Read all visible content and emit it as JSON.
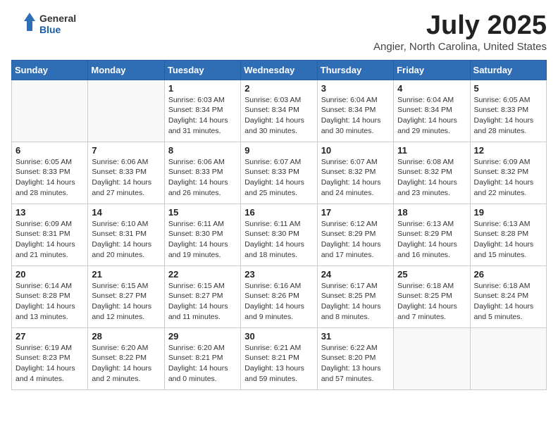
{
  "header": {
    "logo_general": "General",
    "logo_blue": "Blue",
    "month_title": "July 2025",
    "location": "Angier, North Carolina, United States"
  },
  "weekdays": [
    "Sunday",
    "Monday",
    "Tuesday",
    "Wednesday",
    "Thursday",
    "Friday",
    "Saturday"
  ],
  "weeks": [
    [
      {
        "day": "",
        "info": ""
      },
      {
        "day": "",
        "info": ""
      },
      {
        "day": "1",
        "info": "Sunrise: 6:03 AM\nSunset: 8:34 PM\nDaylight: 14 hours and 31 minutes."
      },
      {
        "day": "2",
        "info": "Sunrise: 6:03 AM\nSunset: 8:34 PM\nDaylight: 14 hours and 30 minutes."
      },
      {
        "day": "3",
        "info": "Sunrise: 6:04 AM\nSunset: 8:34 PM\nDaylight: 14 hours and 30 minutes."
      },
      {
        "day": "4",
        "info": "Sunrise: 6:04 AM\nSunset: 8:34 PM\nDaylight: 14 hours and 29 minutes."
      },
      {
        "day": "5",
        "info": "Sunrise: 6:05 AM\nSunset: 8:33 PM\nDaylight: 14 hours and 28 minutes."
      }
    ],
    [
      {
        "day": "6",
        "info": "Sunrise: 6:05 AM\nSunset: 8:33 PM\nDaylight: 14 hours and 28 minutes."
      },
      {
        "day": "7",
        "info": "Sunrise: 6:06 AM\nSunset: 8:33 PM\nDaylight: 14 hours and 27 minutes."
      },
      {
        "day": "8",
        "info": "Sunrise: 6:06 AM\nSunset: 8:33 PM\nDaylight: 14 hours and 26 minutes."
      },
      {
        "day": "9",
        "info": "Sunrise: 6:07 AM\nSunset: 8:33 PM\nDaylight: 14 hours and 25 minutes."
      },
      {
        "day": "10",
        "info": "Sunrise: 6:07 AM\nSunset: 8:32 PM\nDaylight: 14 hours and 24 minutes."
      },
      {
        "day": "11",
        "info": "Sunrise: 6:08 AM\nSunset: 8:32 PM\nDaylight: 14 hours and 23 minutes."
      },
      {
        "day": "12",
        "info": "Sunrise: 6:09 AM\nSunset: 8:32 PM\nDaylight: 14 hours and 22 minutes."
      }
    ],
    [
      {
        "day": "13",
        "info": "Sunrise: 6:09 AM\nSunset: 8:31 PM\nDaylight: 14 hours and 21 minutes."
      },
      {
        "day": "14",
        "info": "Sunrise: 6:10 AM\nSunset: 8:31 PM\nDaylight: 14 hours and 20 minutes."
      },
      {
        "day": "15",
        "info": "Sunrise: 6:11 AM\nSunset: 8:30 PM\nDaylight: 14 hours and 19 minutes."
      },
      {
        "day": "16",
        "info": "Sunrise: 6:11 AM\nSunset: 8:30 PM\nDaylight: 14 hours and 18 minutes."
      },
      {
        "day": "17",
        "info": "Sunrise: 6:12 AM\nSunset: 8:29 PM\nDaylight: 14 hours and 17 minutes."
      },
      {
        "day": "18",
        "info": "Sunrise: 6:13 AM\nSunset: 8:29 PM\nDaylight: 14 hours and 16 minutes."
      },
      {
        "day": "19",
        "info": "Sunrise: 6:13 AM\nSunset: 8:28 PM\nDaylight: 14 hours and 15 minutes."
      }
    ],
    [
      {
        "day": "20",
        "info": "Sunrise: 6:14 AM\nSunset: 8:28 PM\nDaylight: 14 hours and 13 minutes."
      },
      {
        "day": "21",
        "info": "Sunrise: 6:15 AM\nSunset: 8:27 PM\nDaylight: 14 hours and 12 minutes."
      },
      {
        "day": "22",
        "info": "Sunrise: 6:15 AM\nSunset: 8:27 PM\nDaylight: 14 hours and 11 minutes."
      },
      {
        "day": "23",
        "info": "Sunrise: 6:16 AM\nSunset: 8:26 PM\nDaylight: 14 hours and 9 minutes."
      },
      {
        "day": "24",
        "info": "Sunrise: 6:17 AM\nSunset: 8:25 PM\nDaylight: 14 hours and 8 minutes."
      },
      {
        "day": "25",
        "info": "Sunrise: 6:18 AM\nSunset: 8:25 PM\nDaylight: 14 hours and 7 minutes."
      },
      {
        "day": "26",
        "info": "Sunrise: 6:18 AM\nSunset: 8:24 PM\nDaylight: 14 hours and 5 minutes."
      }
    ],
    [
      {
        "day": "27",
        "info": "Sunrise: 6:19 AM\nSunset: 8:23 PM\nDaylight: 14 hours and 4 minutes."
      },
      {
        "day": "28",
        "info": "Sunrise: 6:20 AM\nSunset: 8:22 PM\nDaylight: 14 hours and 2 minutes."
      },
      {
        "day": "29",
        "info": "Sunrise: 6:20 AM\nSunset: 8:21 PM\nDaylight: 14 hours and 0 minutes."
      },
      {
        "day": "30",
        "info": "Sunrise: 6:21 AM\nSunset: 8:21 PM\nDaylight: 13 hours and 59 minutes."
      },
      {
        "day": "31",
        "info": "Sunrise: 6:22 AM\nSunset: 8:20 PM\nDaylight: 13 hours and 57 minutes."
      },
      {
        "day": "",
        "info": ""
      },
      {
        "day": "",
        "info": ""
      }
    ]
  ]
}
